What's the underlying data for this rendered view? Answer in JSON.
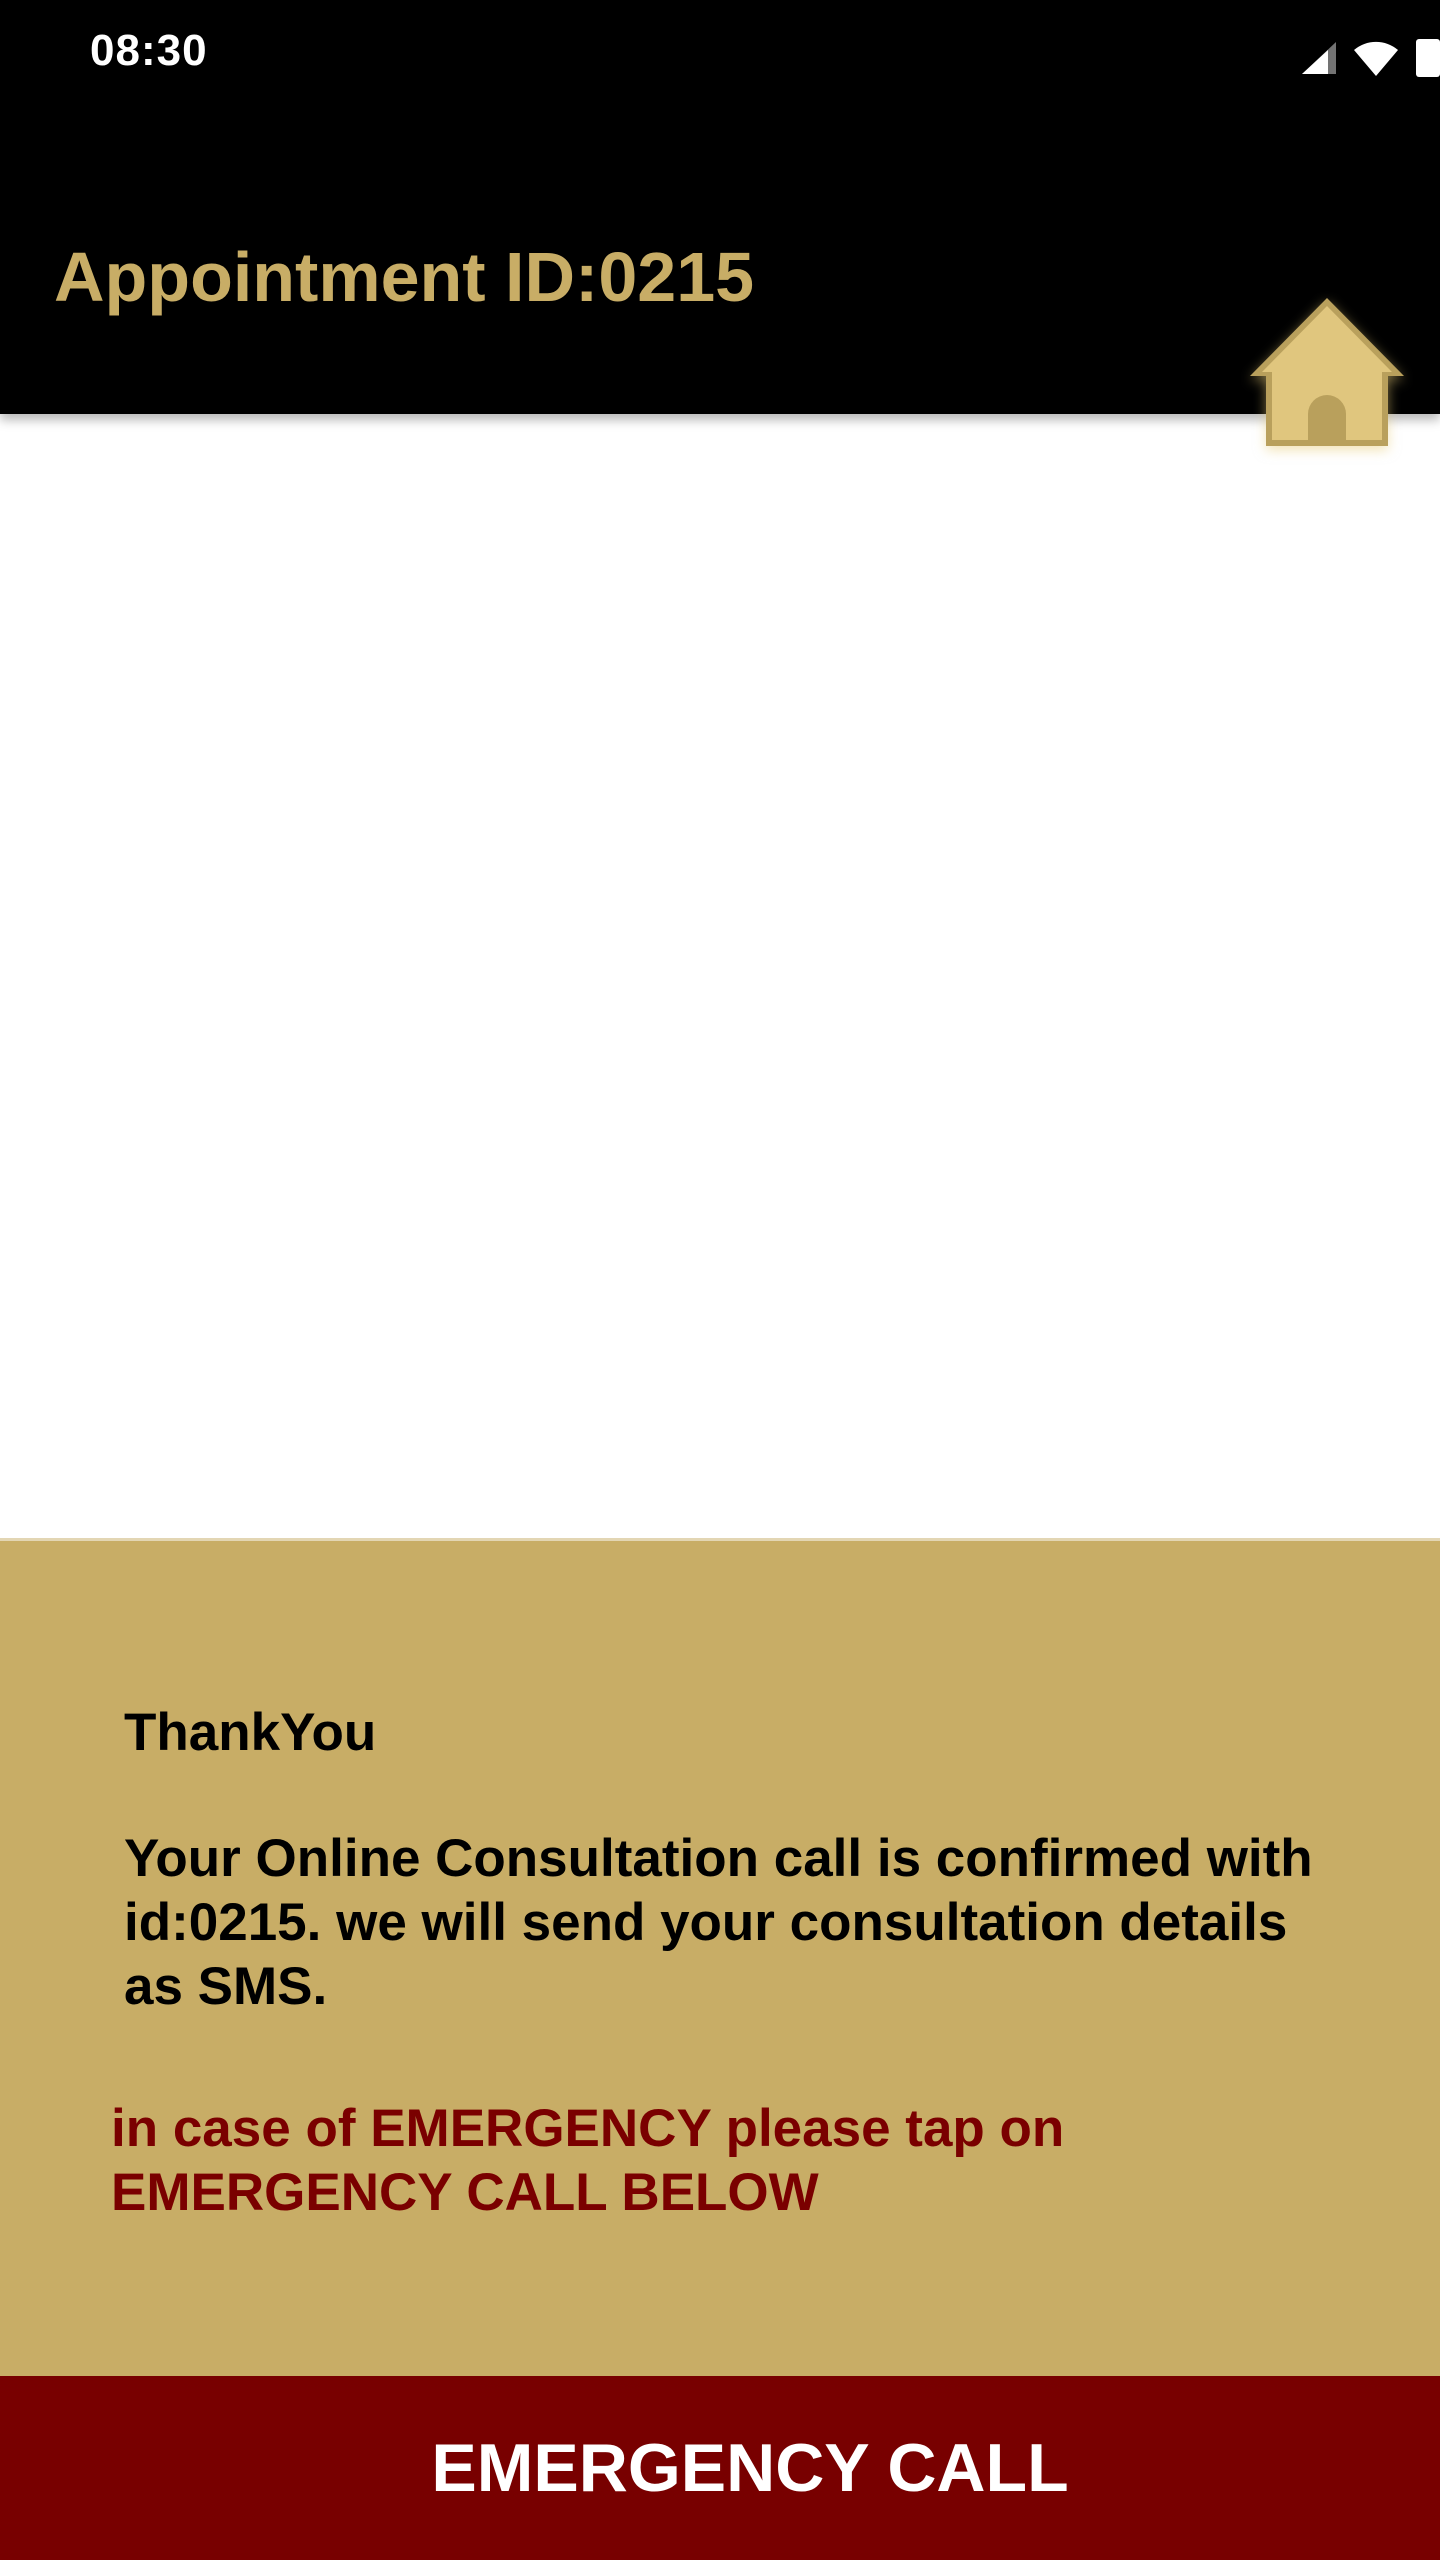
{
  "status_bar": {
    "time": "08:30",
    "icons": [
      "cellular-signal-icon",
      "wifi-icon",
      "battery-icon"
    ]
  },
  "app_bar": {
    "title": "Appointment ID:0215",
    "home_icon": "home-icon"
  },
  "message": {
    "heading": "ThankYou",
    "body": "Your Online Consultation call is confirmed with id:0215. we will send your consultation details as SMS.",
    "emergency_note": "in case of EMERGENCY please tap on EMERGENCY CALL BELOW"
  },
  "emergency_button": {
    "label": "EMERGENCY CALL"
  },
  "colors": {
    "header_bg": "#000000",
    "accent_gold": "#c8ad66",
    "emergency_red": "#780000",
    "note_red": "#7a0000"
  }
}
